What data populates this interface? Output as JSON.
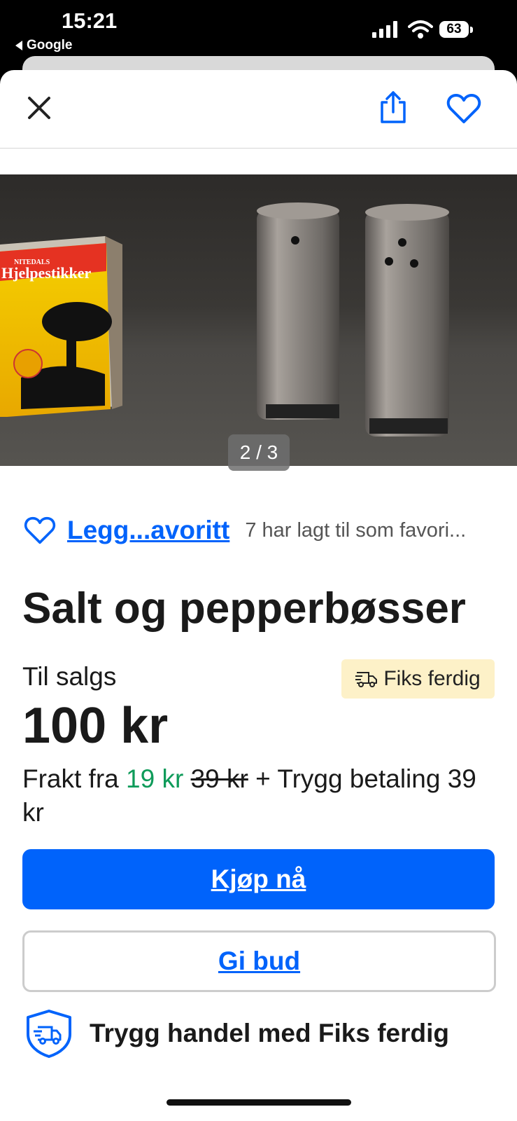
{
  "status_bar": {
    "time": "15:21",
    "back_app": "Google",
    "battery": "63"
  },
  "image_viewer": {
    "counter": "2 / 3",
    "matchbox_brand": "NITEDALS",
    "matchbox_name": "Hjelpestikker"
  },
  "favorite": {
    "link_label": "Legg...avoritt",
    "count_text": "7 har lagt til som favori..."
  },
  "listing": {
    "title": "Salt og pepperbøsser",
    "status": "Til salgs",
    "badge": "Fiks ferdig",
    "price": "100 kr",
    "shipping_prefix": "Frakt fra",
    "shipping_price": "19 kr",
    "shipping_old_price": "39 kr",
    "shipping_suffix": "+ Trygg betaling 39 kr"
  },
  "actions": {
    "buy_label": "Kjøp nå",
    "bid_label": "Gi bud"
  },
  "trust": {
    "text": "Trygg handel med Fiks ferdig"
  },
  "colors": {
    "accent": "#0063fb",
    "green": "#0f9b5a",
    "badge_bg": "#fdf1c8"
  }
}
